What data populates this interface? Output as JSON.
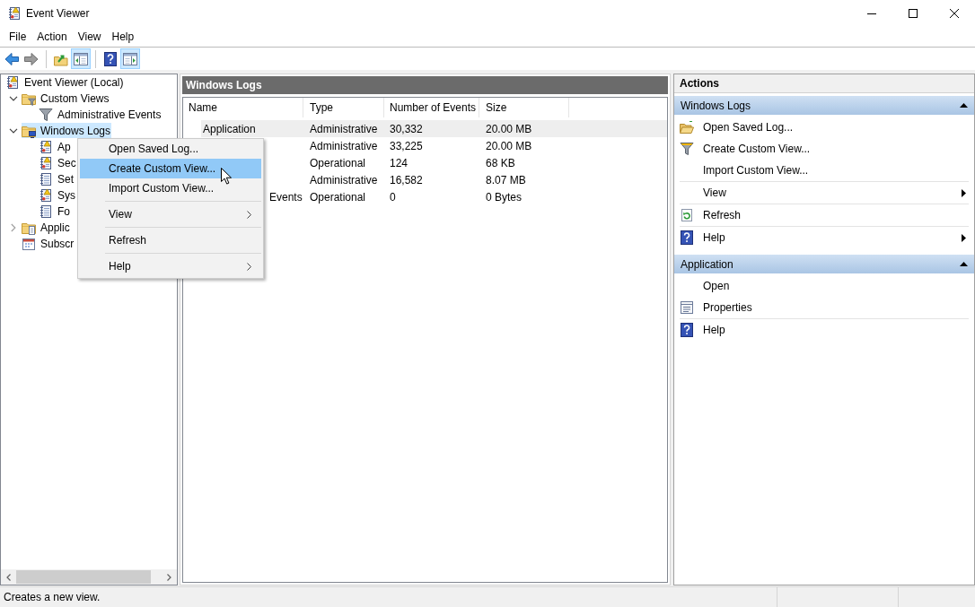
{
  "window": {
    "title": "Event Viewer"
  },
  "menu_bar": [
    "File",
    "Action",
    "View",
    "Help"
  ],
  "toolbar": [
    {
      "kind": "button",
      "disabled": false,
      "pressed": false
    },
    {
      "kind": "button",
      "disabled": true,
      "pressed": false
    },
    {
      "kind": "separator"
    },
    {
      "kind": "button",
      "disabled": false,
      "pressed": false
    },
    {
      "kind": "button",
      "disabled": false,
      "pressed": true
    },
    {
      "kind": "separator"
    },
    {
      "kind": "button",
      "disabled": false,
      "pressed": false
    },
    {
      "kind": "button",
      "disabled": false,
      "pressed": true
    }
  ],
  "tree": [
    {
      "label": "Event Viewer (Local)",
      "selected": false,
      "children": [
        {
          "label": "Custom Views",
          "expanded": true,
          "selected": false,
          "children": [
            {
              "label": "Administrative Events",
              "selected": false
            }
          ]
        },
        {
          "label": "Windows Logs",
          "expanded": true,
          "selected": true,
          "children": [
            {
              "label": "Ap",
              "selected": false
            },
            {
              "label": "Sec",
              "selected": false
            },
            {
              "label": "Set",
              "selected": false
            },
            {
              "label": "Sys",
              "selected": false
            },
            {
              "label": "Fo",
              "selected": false
            }
          ]
        },
        {
          "label": "Applic",
          "expanded": false,
          "selected": false
        },
        {
          "label": "Subscr",
          "selected": false
        }
      ]
    }
  ],
  "center_pane": {
    "title": "Windows Logs",
    "columns": [
      "Name",
      "Type",
      "Number of Events",
      "Size"
    ],
    "rows": [
      {
        "name": "Application",
        "type": "Administrative",
        "events": "30,332",
        "size": "20.00 MB",
        "selected": true
      },
      {
        "type": "Administrative",
        "events": "33,225",
        "size": "20.00 MB",
        "selected": false
      },
      {
        "type": "Operational",
        "events": "124",
        "size": "68 KB",
        "selected": false
      },
      {
        "type": "Administrative",
        "events": "16,582",
        "size": "8.07 MB",
        "selected": false
      },
      {
        "name": "Events",
        "type": "Operational",
        "events": "0",
        "size": "0 Bytes",
        "selected": false
      }
    ]
  },
  "context_menu": {
    "items": [
      {
        "kind": "item",
        "label": "Open Saved Log...",
        "selected": false,
        "submenu": false
      },
      {
        "kind": "item",
        "label": "Create Custom View...",
        "selected": true,
        "submenu": false
      },
      {
        "kind": "item",
        "label": "Import Custom View...",
        "selected": false,
        "submenu": false
      },
      {
        "kind": "separator"
      },
      {
        "kind": "item",
        "label": "View",
        "selected": false,
        "submenu": true
      },
      {
        "kind": "separator"
      },
      {
        "kind": "item",
        "label": "Refresh",
        "selected": false,
        "submenu": false
      },
      {
        "kind": "separator"
      },
      {
        "kind": "item",
        "label": "Help",
        "selected": false,
        "submenu": true
      }
    ]
  },
  "actions_pane": {
    "title": "Actions",
    "sections": [
      {
        "title": "Windows Logs",
        "expanded": true,
        "items": [
          {
            "kind": "action",
            "label": "Open Saved Log...",
            "submenu": false
          },
          {
            "kind": "action",
            "label": "Create Custom View...",
            "submenu": false
          },
          {
            "kind": "action",
            "label": "Import Custom View...",
            "submenu": false
          },
          {
            "kind": "separator"
          },
          {
            "kind": "action",
            "label": "View",
            "submenu": true
          },
          {
            "kind": "separator"
          },
          {
            "kind": "action",
            "label": "Refresh",
            "submenu": false
          },
          {
            "kind": "separator"
          },
          {
            "kind": "action",
            "label": "Help",
            "submenu": true
          }
        ]
      },
      {
        "title": "Application",
        "expanded": true,
        "items": [
          {
            "kind": "action",
            "label": "Open",
            "submenu": false
          },
          {
            "kind": "action",
            "label": "Properties",
            "submenu": false
          },
          {
            "kind": "separator"
          },
          {
            "kind": "action",
            "label": "Help",
            "submenu": false
          }
        ]
      }
    ]
  },
  "status_bar": {
    "text": "Creates a new view."
  }
}
